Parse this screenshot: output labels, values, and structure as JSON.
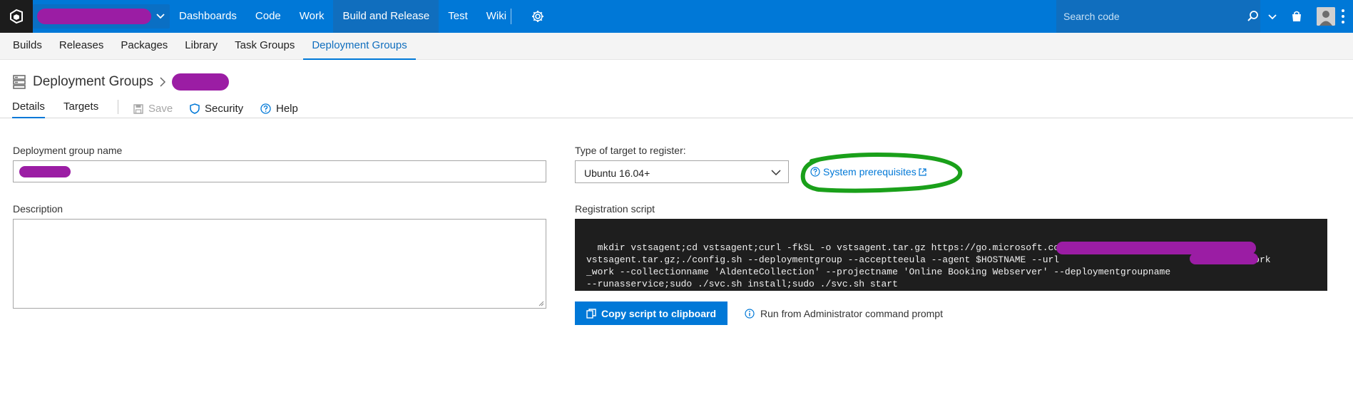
{
  "topbar": {
    "nav": [
      "Dashboards",
      "Code",
      "Work",
      "Build and Release",
      "Test",
      "Wiki"
    ],
    "search_placeholder": "Search code"
  },
  "subnav": {
    "items": [
      "Builds",
      "Releases",
      "Packages",
      "Library",
      "Task Groups",
      "Deployment Groups"
    ]
  },
  "header": {
    "title": "Deployment Groups"
  },
  "toolbar": {
    "tab_details": "Details",
    "tab_targets": "Targets",
    "save": "Save",
    "security": "Security",
    "help": "Help"
  },
  "form": {
    "name_label": "Deployment group name",
    "description_label": "Description",
    "target_label": "Type of target to register:",
    "target_value": "Ubuntu 16.04+",
    "prereq_link": "System prerequisites",
    "script_label": "Registration script",
    "script_text": "mkdir vstsagent;cd vstsagent;curl -fkSL -o vstsagent.tar.gz https://go.microsoft.com/fwlink/?linkid=858949;tar -zxvf\nvstsagent.tar.gz;./config.sh --deploymentgroup --accepttеeula --agent $HOSTNAME --url                                --work\n_work --collectionname 'AldenteCollection' --projectname 'Online Booking Webserver' --deploymentgroupname\n--runasservice;sudo ./svc.sh install;sudo ./svc.sh start",
    "copy_button": "Copy script to clipboard",
    "run_hint": "Run from Administrator command prompt"
  },
  "colors": {
    "accent": "#0078d7",
    "topbar": "#0078d7",
    "redaction": "#9b1da4",
    "annotation": "#1aa01a"
  }
}
